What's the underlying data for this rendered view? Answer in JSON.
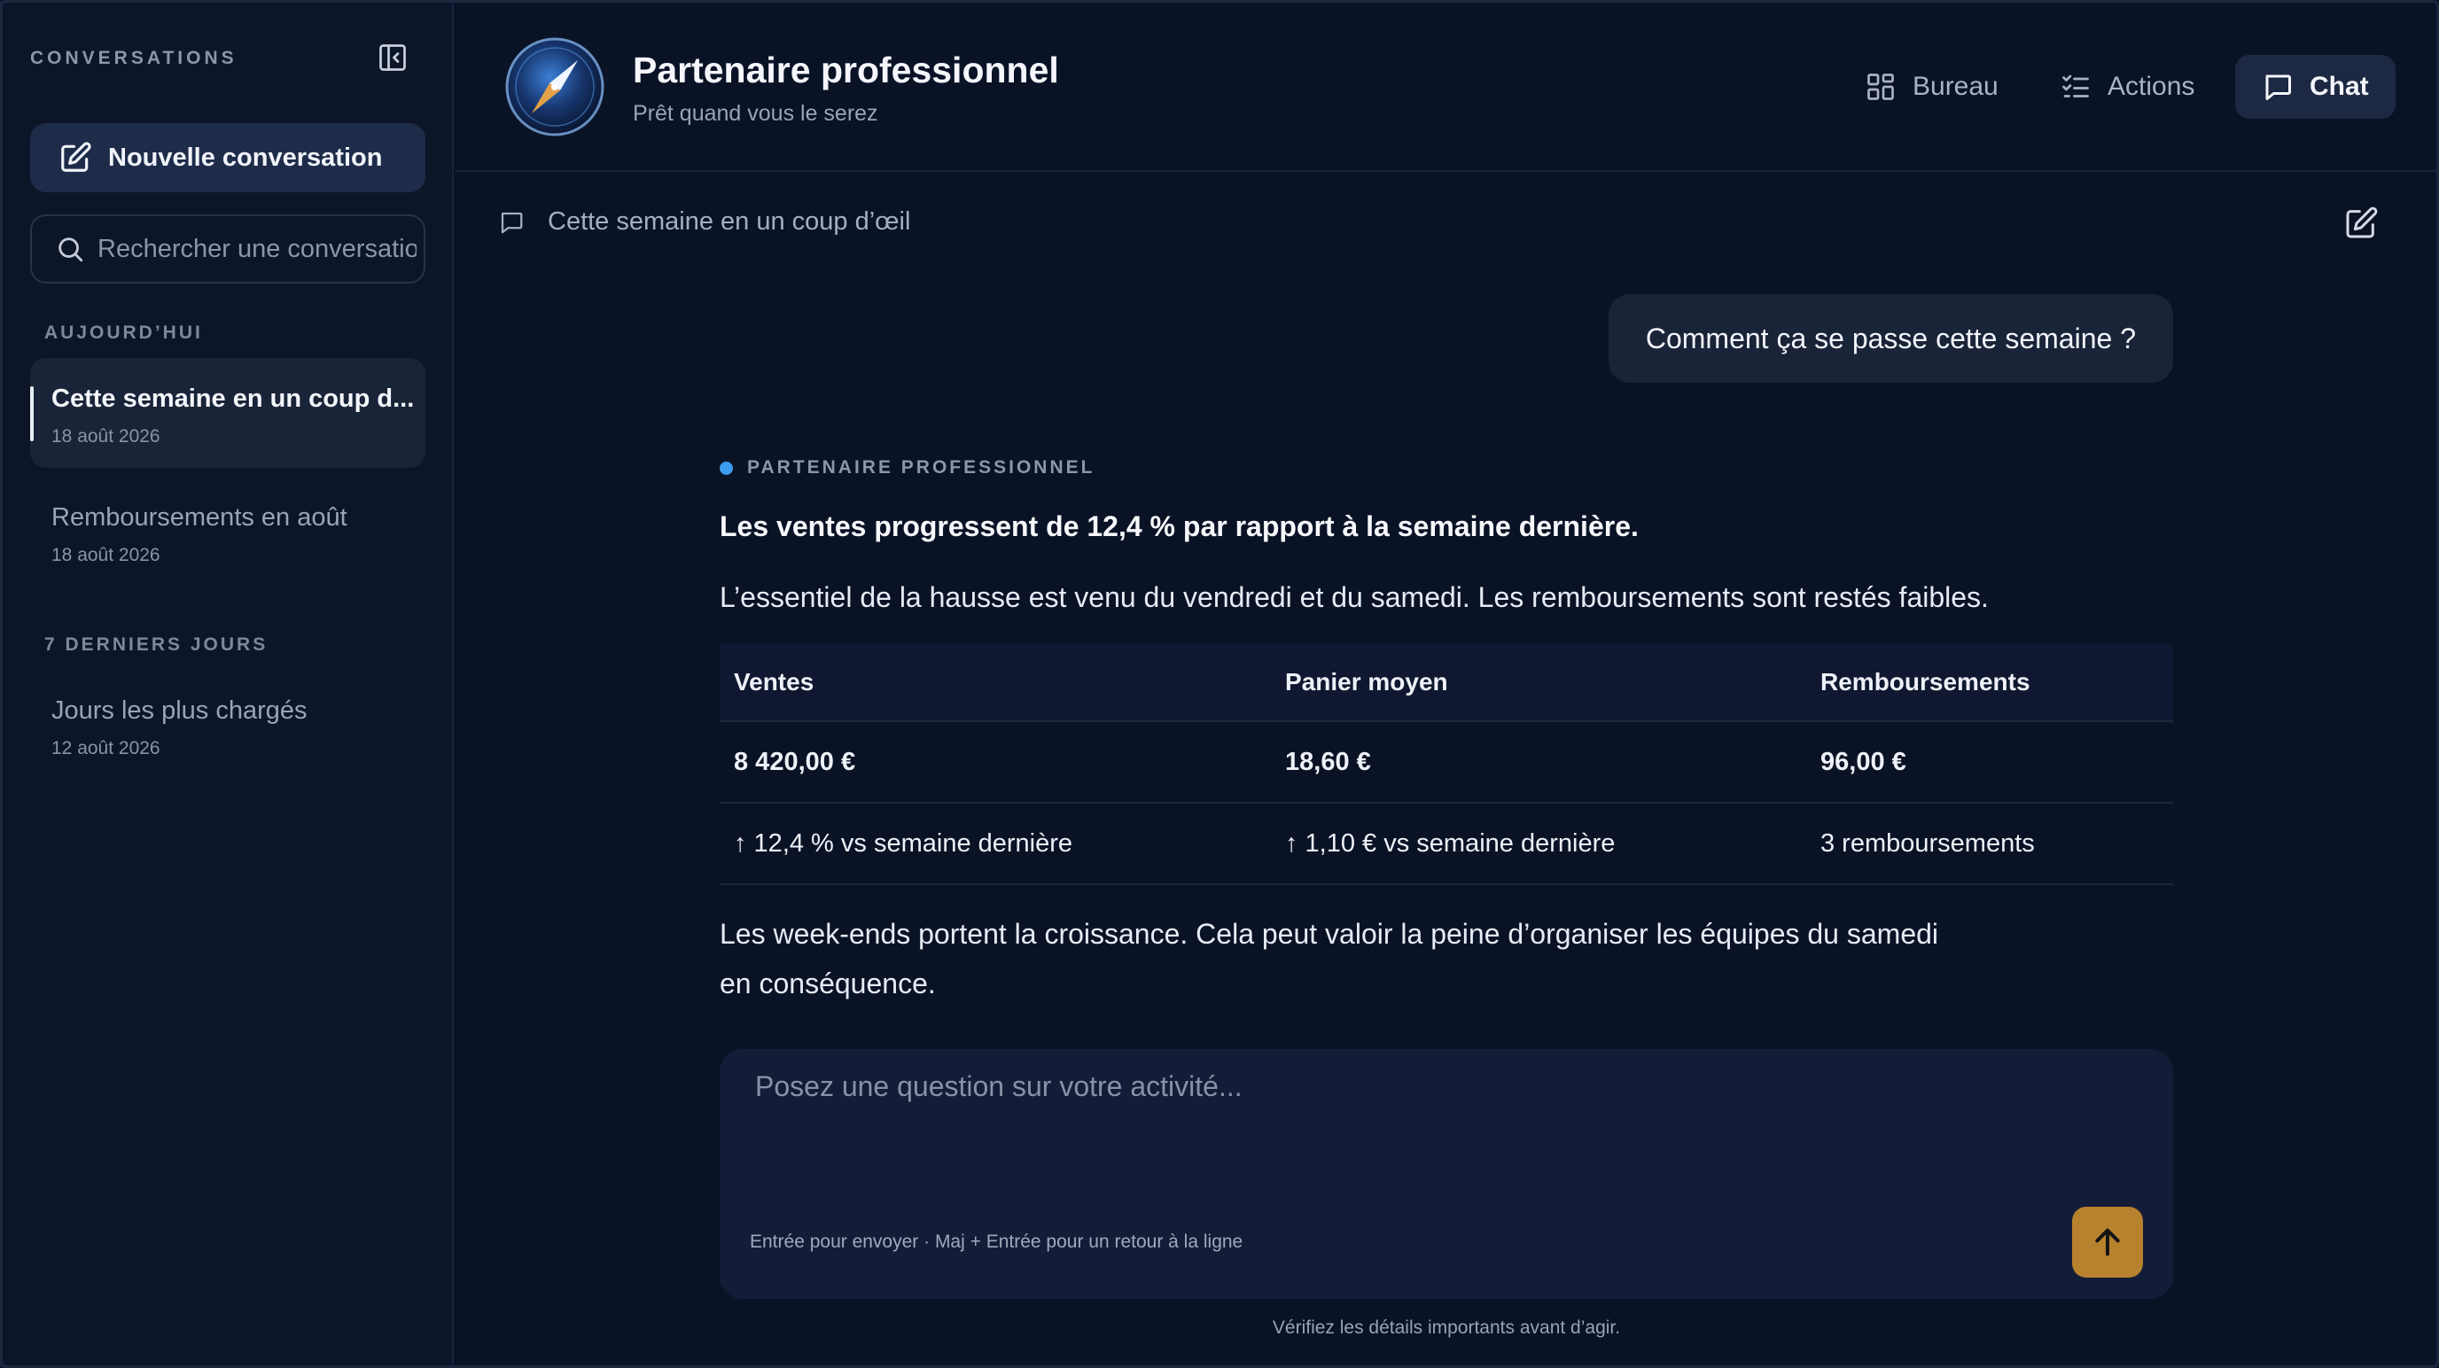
{
  "sidebar": {
    "title": "CONVERSATIONS",
    "new_conversation": "Nouvelle conversation",
    "search_placeholder": "Rechercher une conversation",
    "sections": [
      {
        "label": "AUJOURD’HUI",
        "items": [
          {
            "title": "Cette semaine en un coup d...",
            "date": "18 août 2026",
            "active": true
          },
          {
            "title": "Remboursements en août",
            "date": "18 août 2026",
            "active": false
          }
        ]
      },
      {
        "label": "7 DERNIERS JOURS",
        "items": [
          {
            "title": "Jours les plus chargés",
            "date": "12 août 2026",
            "active": false
          }
        ]
      }
    ]
  },
  "header": {
    "title": "Partenaire professionnel",
    "subtitle": "Prêt quand vous le serez",
    "nav": [
      {
        "label": "Bureau",
        "icon": "grid-icon",
        "active": false
      },
      {
        "label": "Actions",
        "icon": "checklist-icon",
        "active": false
      },
      {
        "label": "Chat",
        "icon": "chat-bubble-icon",
        "active": true
      }
    ]
  },
  "conversation": {
    "title": "Cette semaine en un coup d’œil",
    "user_message": "Comment ça se passe cette semaine ?",
    "assistant_label": "PARTENAIRE PROFESSIONNEL",
    "headline": "Les ventes progressent de 12,4 % par rapport à la semaine dernière.",
    "paragraph1": "L’essentiel de la hausse est venu du vendredi et du samedi. Les remboursements sont restés faibles.",
    "table": {
      "headers": [
        "Ventes",
        "Panier moyen",
        "Remboursements"
      ],
      "rows": [
        [
          "8 420,00 €",
          "18,60 €",
          "96,00 €"
        ],
        [
          "↑ 12,4 % vs semaine dernière",
          "↑ 1,10 € vs semaine dernière",
          "3 remboursements"
        ]
      ]
    },
    "paragraph2_line1": "Les week-ends portent la croissance. Cela peut valoir la peine d’organiser les équipes du samedi",
    "paragraph2_line2": "en conséquence."
  },
  "composer": {
    "placeholder": "Posez une question sur votre activité...",
    "hint": "Entrée pour envoyer · Maj + Entrée pour un retour à la ligne",
    "footer": "Vérifiez les détails importants avant d’agir."
  },
  "colors": {
    "background": "#0a1326",
    "sidebar": "#0d1629",
    "accent_send": "#b7822e",
    "assistant_dot": "#3b9cf0"
  }
}
